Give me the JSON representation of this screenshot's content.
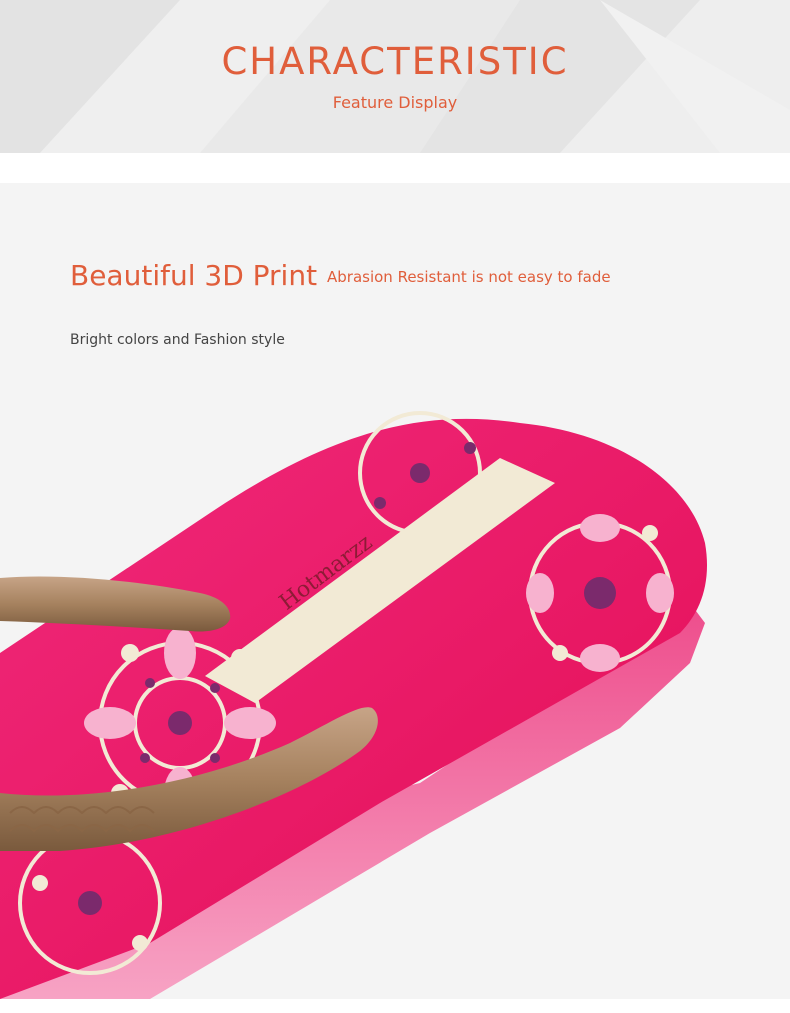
{
  "header": {
    "title": "CHARACTERISTIC",
    "subtitle": "Feature Display"
  },
  "feature": {
    "title": "Beautiful 3D Print",
    "note": "Abrasion Resistant is not easy to fade",
    "description": "Bright colors and Fashion style"
  },
  "product": {
    "brand_print": "Hotmarzz"
  },
  "colors": {
    "accent": "#e05e3b",
    "sole_pink": "#e8155f",
    "strap_bronze": "#a5825f",
    "panel_bg": "#f4f4f4",
    "header_bg": "#e9e9e9"
  }
}
